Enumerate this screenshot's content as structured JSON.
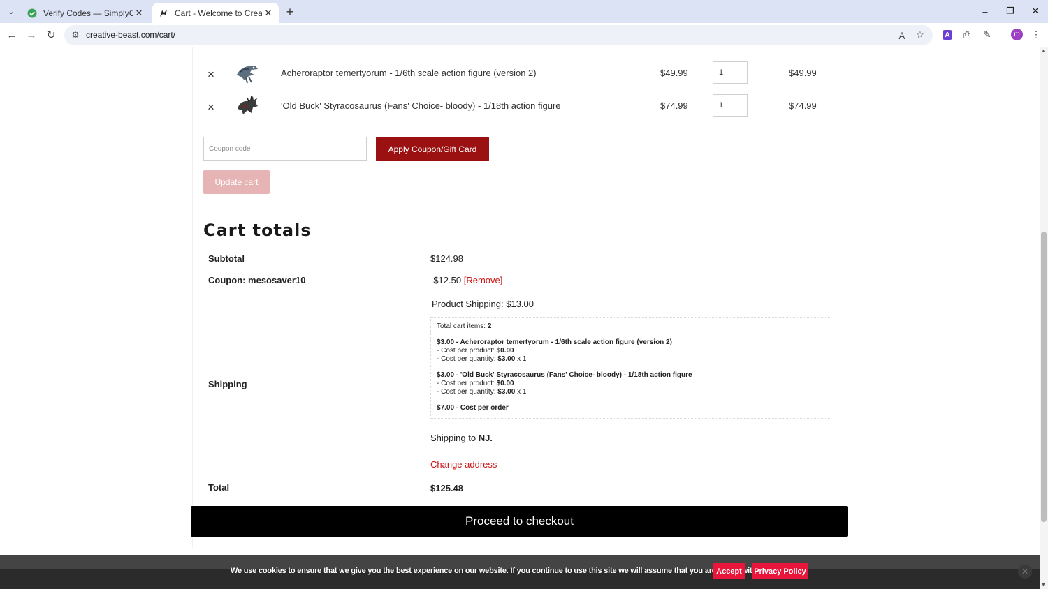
{
  "browser": {
    "tabs": [
      {
        "title": "Verify Codes — SimplyCodes",
        "active": false,
        "icon": "simplycodes-favicon"
      },
      {
        "title": "Cart - Welcome to Creative Bea",
        "active": true,
        "icon": "creative-beast-favicon"
      }
    ],
    "url": "creative-beast.com/cart/",
    "profile_initial": "m",
    "extension_label": "A"
  },
  "cart": {
    "items": [
      {
        "name": "Acheroraptor temertyorum - 1/6th scale action figure (version 2)",
        "price": "$49.99",
        "quantity": "1",
        "subtotal": "$49.99"
      },
      {
        "name": "'Old Buck' Styracosaurus (Fans' Choice- bloody) - 1/18th action figure",
        "price": "$74.99",
        "quantity": "1",
        "subtotal": "$74.99"
      }
    ],
    "coupon_placeholder": "Coupon code",
    "apply_label": "Apply Coupon/Gift Card",
    "update_label": "Update cart"
  },
  "totals": {
    "title": "Cart totals",
    "subtotal_label": "Subtotal",
    "subtotal_value": "$124.98",
    "coupon_label": "Coupon: mesosaver10",
    "coupon_value": "-$12.50",
    "coupon_remove": "[Remove]",
    "shipping_label": "Shipping",
    "product_shipping": "Product Shipping: $13.00",
    "breakdown": {
      "total_items_label": "Total cart items:",
      "total_items_value": "2",
      "item1_line": "$3.00 - Acheroraptor temertyorum - 1/6th scale action figure (version 2)",
      "item1_cpp_label": "- Cost per product:",
      "item1_cpp_value": "$0.00",
      "item1_cpq_label": "- Cost per quantity:",
      "item1_cpq_value": "$3.00",
      "item1_cpq_mult": "x 1",
      "item2_line": "$3.00 - 'Old Buck' Styracosaurus (Fans' Choice- bloody) - 1/18th action figure",
      "item2_cpp_label": "- Cost per product:",
      "item2_cpp_value": "$0.00",
      "item2_cpq_label": "- Cost per quantity:",
      "item2_cpq_value": "$3.00",
      "item2_cpq_mult": "x 1",
      "order_line": "$7.00 - Cost per order"
    },
    "shipping_to_prefix": "Shipping to",
    "shipping_to_state": "NJ.",
    "change_address": "Change address",
    "total_label": "Total",
    "total_value": "$125.48"
  },
  "checkout_label": "Proceed to checkout",
  "cookie": {
    "message": "We use cookies to ensure that we give you the best experience on our website. If you continue to use this site we will assume that you are happy with it.",
    "accept_label": "Accept",
    "privacy_label": "Privacy Policy"
  },
  "colors": {
    "brand_red": "#9b1010",
    "link_red": "#cc1111",
    "cookie_red": "#e8163b",
    "checkout_black": "#000000"
  }
}
